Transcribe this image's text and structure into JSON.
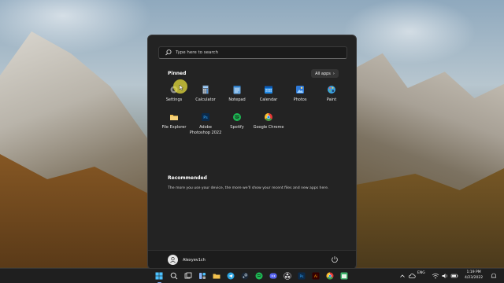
{
  "start_menu": {
    "search": {
      "placeholder": "Type here to search"
    },
    "pinned": {
      "title": "Pinned",
      "all_apps_label": "All apps",
      "apps": [
        {
          "label": "Settings",
          "icon": "gear-icon",
          "color": "#8a8a8a"
        },
        {
          "label": "Calculator",
          "icon": "calculator-icon",
          "color": "#5d6b7a"
        },
        {
          "label": "Notepad",
          "icon": "notepad-icon",
          "color": "#6aa8e0"
        },
        {
          "label": "Calendar",
          "icon": "calendar-icon",
          "color": "#1e88e5"
        },
        {
          "label": "Photos",
          "icon": "photos-icon",
          "color": "#2f7ad8"
        },
        {
          "label": "Paint",
          "icon": "paint-icon",
          "color": "#3aa0e0"
        },
        {
          "label": "File Explorer",
          "icon": "folder-icon",
          "color": "#f2c14e"
        },
        {
          "label": "Adobe Photoshop 2022",
          "icon": "photoshop-icon",
          "color": "#0b2a4a"
        },
        {
          "label": "Spotify",
          "icon": "spotify-icon",
          "color": "#1db954"
        },
        {
          "label": "Google Chrome",
          "icon": "chrome-icon",
          "color": "#e53935"
        }
      ]
    },
    "recommended": {
      "title": "Recommended",
      "text": "The more you use your device, the more we'll show your recent files and new apps here."
    },
    "user": {
      "name": "Alexyev1ch"
    }
  },
  "taskbar": {
    "tray": {
      "language": "ENG"
    },
    "clock": {
      "time": "1:19 PM",
      "date": "4/23/2022"
    }
  },
  "colors": {
    "menu_bg": "#232323",
    "accent": "#8ab4f8",
    "cursor_highlight": "#e6dc3c"
  }
}
